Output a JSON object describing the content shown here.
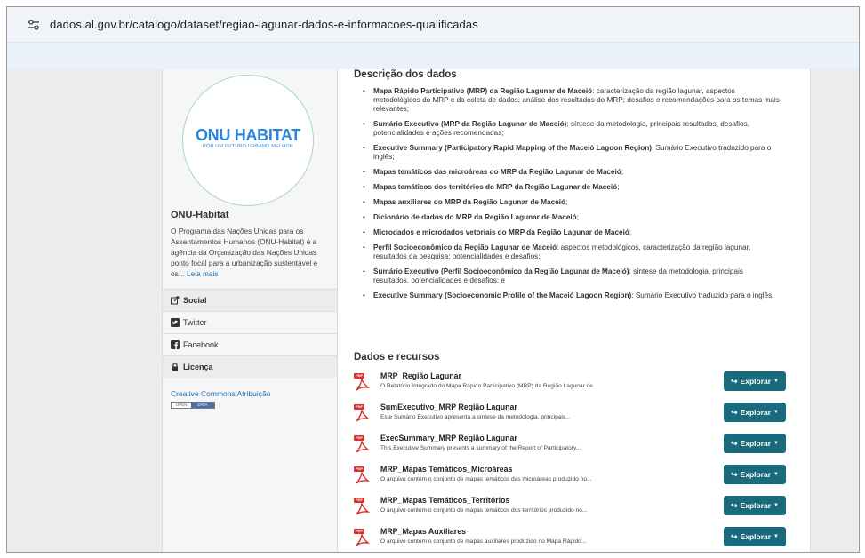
{
  "browser": {
    "url": "dados.al.gov.br/catalogo/dataset/regiao-lagunar-dados-e-informacoes-qualificadas"
  },
  "sidebar": {
    "logo_text": "ONU HABITAT",
    "logo_subtitle": "POR UM FUTURO URBANO MELHOR",
    "org_name": "ONU-Habitat",
    "org_description": "O Programa das Nações Unidas para os Assentamentos Humanos (ONU-Habitat) é a agência da Organização das Nações Unidas ponto focal para a urbanização sustentável e os...",
    "read_more": "Leia mais",
    "social_heading": "Social",
    "twitter": "Twitter",
    "facebook": "Facebook",
    "license_heading": "Licença",
    "license_link": "Creative Commons Atribuição",
    "open_data_badge": [
      "OPEN",
      "DATA"
    ]
  },
  "description": {
    "heading": "Descrição dos dados",
    "items": [
      {
        "bold": "Mapa Rápido Participativo (MRP) da Região Lagunar de Maceió",
        "rest": ": caracterização da região lagunar, aspectos metodológicos do MRP e da coleta de dados; análise dos resultados do MRP; desafios e recomendações para os temas mais relevantes;"
      },
      {
        "bold": "Sumário Executivo (MRP da Região Lagunar de Maceió)",
        "rest": ": síntese da metodologia, principais resultados, desafios, potencialidades e ações recomendadas;"
      },
      {
        "bold": "Executive Summary (Participatory Rapid Mapping of the Maceió Lagoon Region)",
        "rest": ": Sumário Executivo traduzido para o inglês;"
      },
      {
        "bold": "Mapas temáticos das microáreas do MRP da Região Lagunar de Maceió",
        "rest": ";"
      },
      {
        "bold": "Mapas temáticos dos territórios do MRP da Região Lagunar de Maceió",
        "rest": ";"
      },
      {
        "bold": "Mapas auxiliares do MRP da Região Lagunar de Maceió",
        "rest": ";"
      },
      {
        "bold": "Dicionário de dados do MRP da Região Lagunar de Maceió",
        "rest": ";"
      },
      {
        "bold": "Microdados e microdados vetoriais do MRP da Região Lagunar de Maceió",
        "rest": ";"
      },
      {
        "bold": "Perfil Socioeconômico da Região Lagunar de Maceió",
        "rest": ": aspectos metodológicos, caracterização da região lagunar, resultados da pesquisa; potencialidades e desafios;"
      },
      {
        "bold": "Sumário Executivo (Perfil Socioeconômico da Região Lagunar de Maceió)",
        "rest": ": síntese da metodologia, principais resultados, potencialidades e desafios; e"
      },
      {
        "bold": "Executive Summary (Socioeconomic Profile of the Maceió Lagoon Region)",
        "rest": ": Sumário Executivo traduzido para o inglês."
      }
    ]
  },
  "resources": {
    "heading": "Dados e recursos",
    "button_label": "Explorar",
    "items": [
      {
        "format": "PDF",
        "title": "MRP_Região Lagunar",
        "description": "O Relatório Integrado do Mapa Rápido Participativo (MRP) da Região Lagunar de..."
      },
      {
        "format": "PDF",
        "title": "SumExecutivo_MRP Região Lagunar",
        "description": "Este Sumário Executivo apresenta a síntese da metodologia, principais..."
      },
      {
        "format": "PDF",
        "title": "ExecSummary_MRP Região Lagunar",
        "description": "This Executive Summary presents a summary of the Report of Participatory..."
      },
      {
        "format": "PDF",
        "title": "MRP_Mapas Temáticos_Microáreas",
        "description": "O arquivo contém o conjunto de mapas temáticos das microáreas produzido no..."
      },
      {
        "format": "PDF",
        "title": "MRP_Mapas Temáticos_Territórios",
        "description": "O arquivo contém o conjunto de mapas temáticos dos territórios produzido no..."
      },
      {
        "format": "PDF",
        "title": "MRP_Mapas Auxiliares",
        "description": "O arquivo contém o conjunto de mapas auxiliares produzido no Mapa Rápido..."
      }
    ]
  },
  "colors": {
    "button": "#1a6a7e",
    "link": "#1f6fb0",
    "pdf": "#d3342e",
    "logo": "#2a86d8"
  }
}
